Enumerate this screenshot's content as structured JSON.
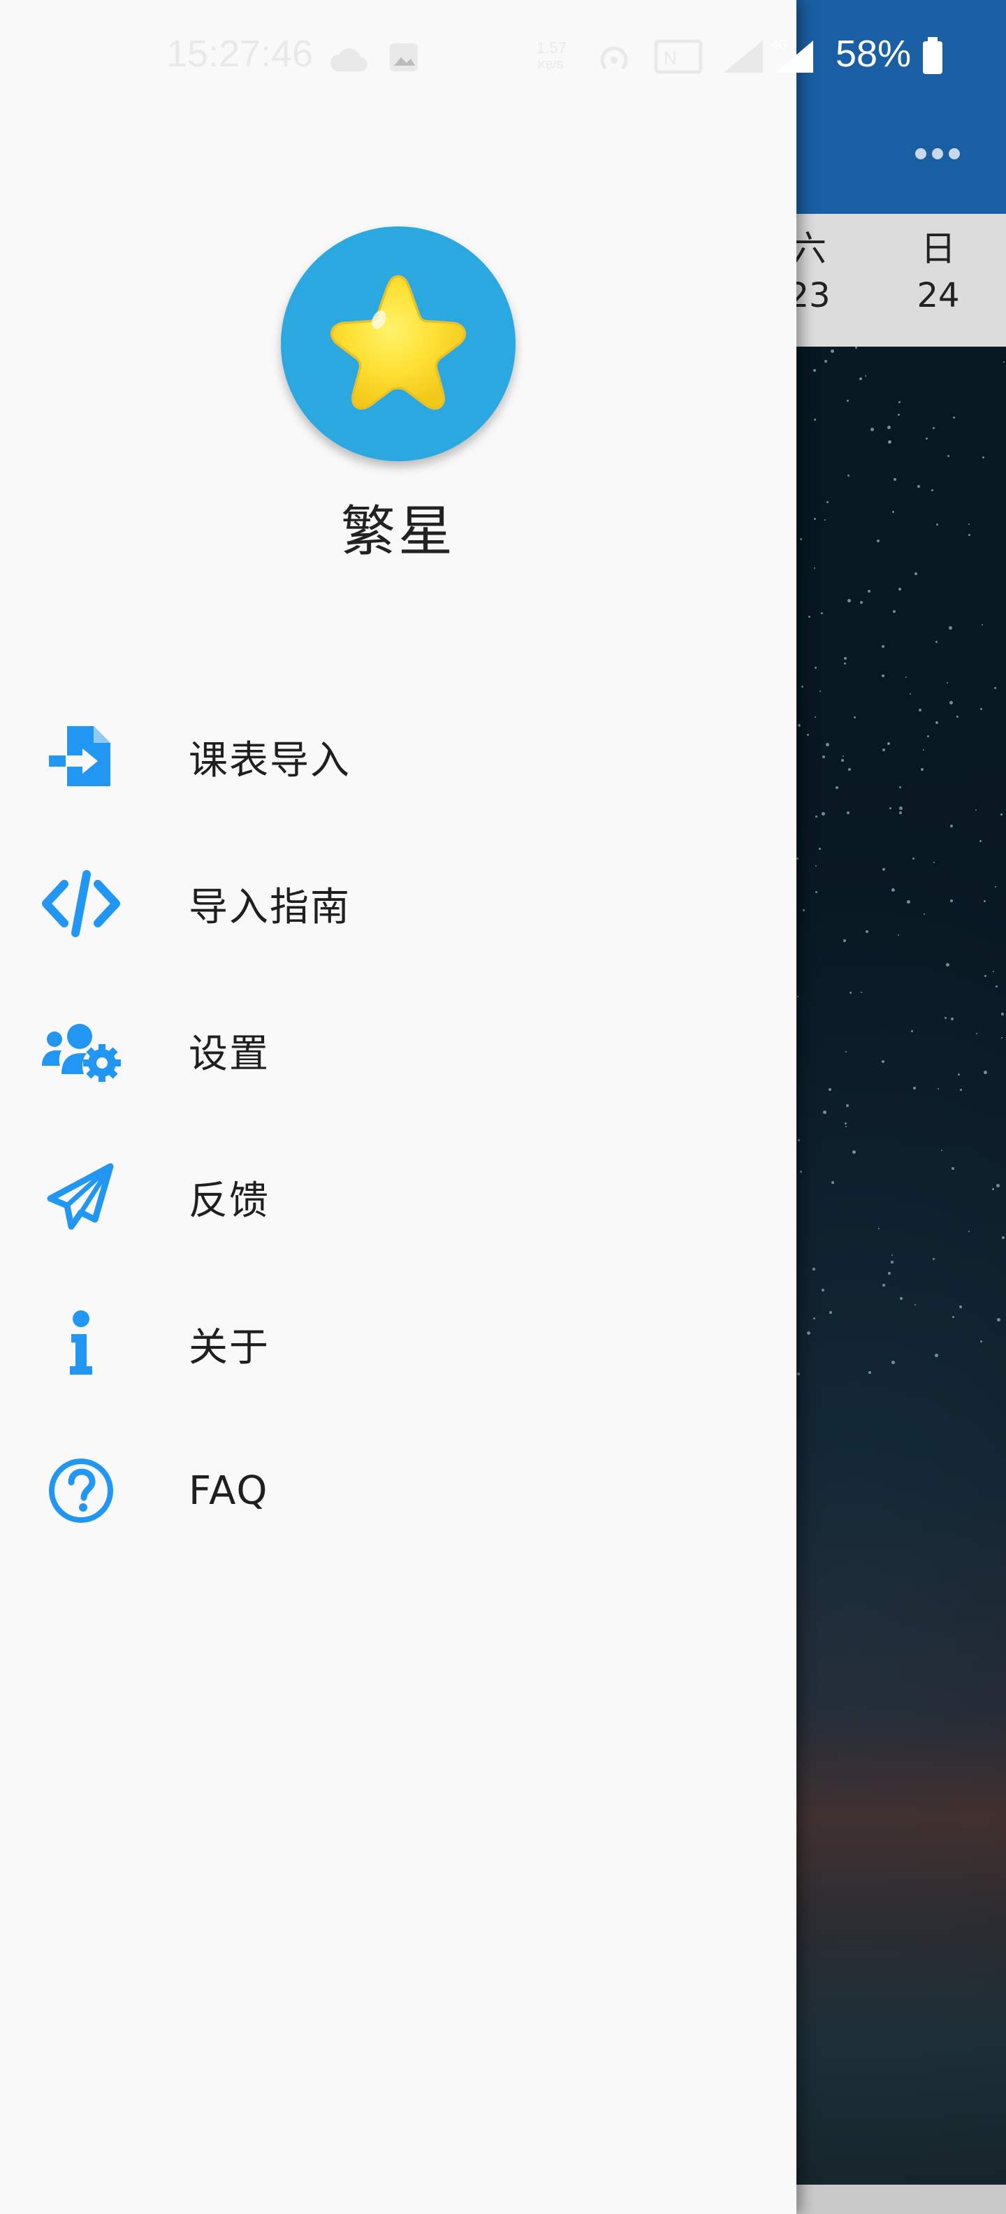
{
  "status_bar": {
    "time": "15:27:46",
    "battery_percent": "58%",
    "icons": [
      "cloud-icon",
      "gallery-icon",
      "network-speed-icon",
      "hotspot-icon",
      "nfc-icon",
      "signal-icon",
      "signal-4g-icon",
      "battery-icon"
    ]
  },
  "background": {
    "weekdays": [
      {
        "name": "六",
        "date": "23"
      },
      {
        "name": "日",
        "date": "24"
      }
    ]
  },
  "drawer": {
    "app_name": "繁星",
    "menu": [
      {
        "label": "课表导入",
        "icon": "file-import-icon"
      },
      {
        "label": "导入指南",
        "icon": "code-icon"
      },
      {
        "label": "设置",
        "icon": "users-cog-icon"
      },
      {
        "label": "反馈",
        "icon": "paper-plane-icon"
      },
      {
        "label": "关于",
        "icon": "info-icon"
      },
      {
        "label": "FAQ",
        "icon": "question-circle-icon"
      }
    ],
    "accent_color": "#2196f3"
  }
}
